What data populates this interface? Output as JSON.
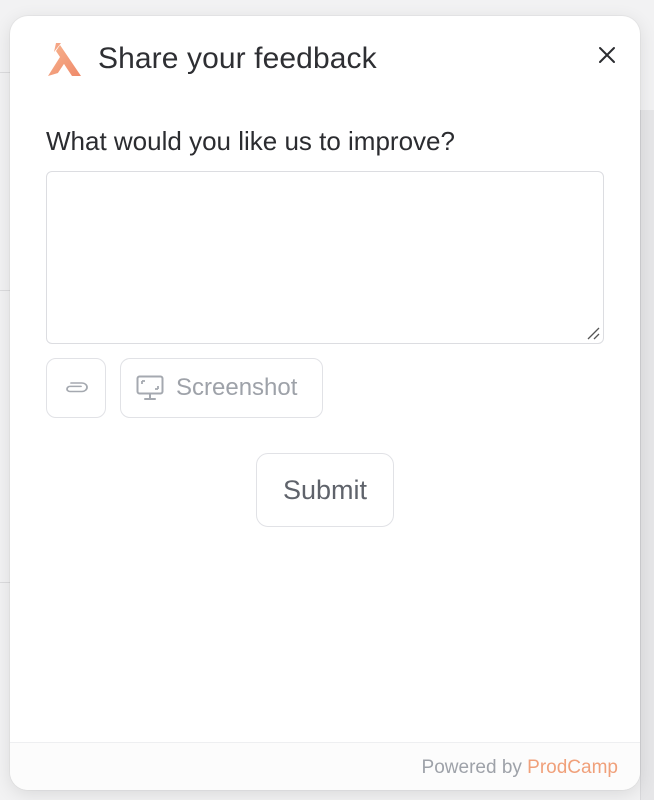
{
  "modal": {
    "title": "Share your feedback",
    "question": "What would you like us to improve?",
    "feedback_value": "",
    "screenshot_label": "Screenshot",
    "submit_label": "Submit",
    "powered_prefix": "Powered by",
    "powered_brand": "ProdCamp"
  },
  "icons": {
    "logo": "prodcamp-logo-icon",
    "close": "close-icon",
    "attach": "paperclip-icon",
    "screenshot": "monitor-screenshot-icon",
    "resize": "resize-handle-icon"
  },
  "colors": {
    "brand_accent": "#f0a07a",
    "muted_text": "#9ea2a9",
    "button_text": "#5f636b",
    "border": "#e1e2e6"
  }
}
